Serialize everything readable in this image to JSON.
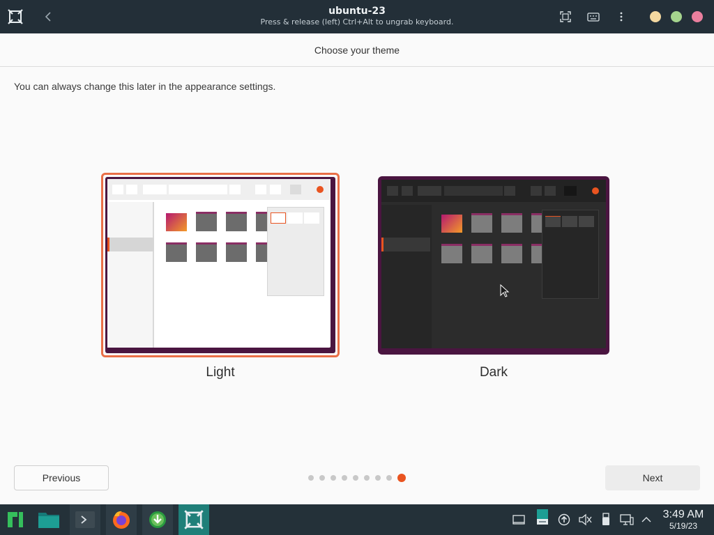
{
  "titlebar": {
    "title": "ubuntu-23",
    "subtitle": "Press & release (left) Ctrl+Alt to ungrab keyboard.",
    "icons": [
      "app-icon",
      "back-icon",
      "fullscreen-icon",
      "keyboard-icon",
      "menu-icon"
    ],
    "window_dots": [
      "#f3d8a0",
      "#a5d48e",
      "#ea7f9e"
    ]
  },
  "installer": {
    "header_title": "Choose your theme",
    "hint": "You can always change this later in the appearance settings.",
    "themes": [
      {
        "label": "Light",
        "selected": true
      },
      {
        "label": "Dark",
        "selected": false
      }
    ],
    "pagination": {
      "total": 9,
      "current": 9
    },
    "previous_label": "Previous",
    "next_label": "Next",
    "accent_color": "#e95420"
  },
  "taskbar": {
    "apps": [
      "manjaro-menu-icon",
      "file-manager-icon",
      "terminal-icon",
      "firefox-icon",
      "download-manager-icon",
      "vm-manager-icon"
    ],
    "tray": [
      "show-desktop-icon",
      "clipboard-icon",
      "update-icon",
      "mute-icon",
      "usb-icon",
      "network-icon",
      "expand-tray-icon"
    ],
    "clock_time": "3:49 AM",
    "clock_date": "5/19/23"
  }
}
